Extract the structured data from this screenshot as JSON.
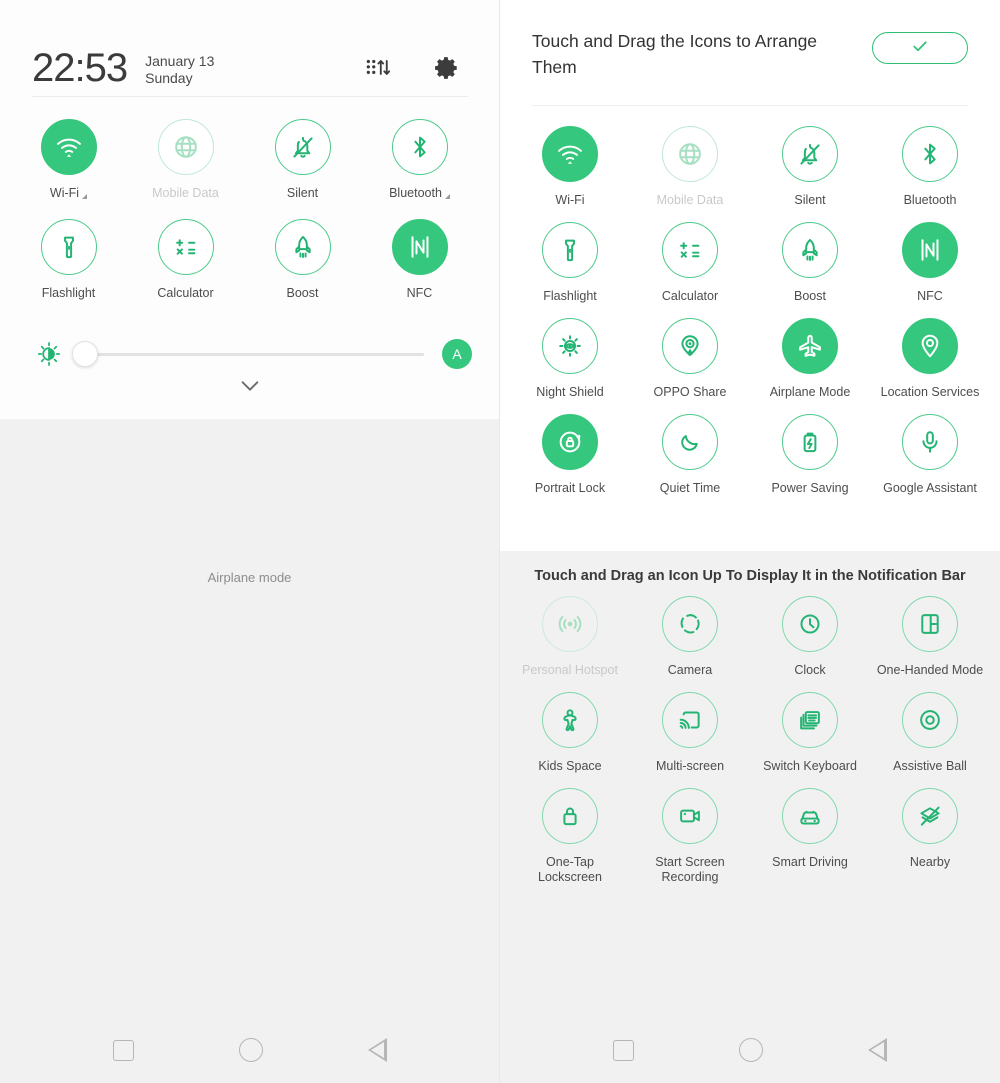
{
  "colors": {
    "accent": "#35c77d",
    "accent_stroke": "#23b473",
    "ring": "#4ccb8a",
    "ring_light": "#7fd9ac",
    "disabled": "#c9c9c9",
    "panel_bg": "#f1f1f1",
    "text": "#4d4d4d"
  },
  "left_panel": {
    "status": {
      "time": "22:53",
      "date": "January 13",
      "weekday": "Sunday",
      "edit_icon": "drag-sort-icon",
      "settings_icon": "gear-icon"
    },
    "tiles": [
      [
        {
          "label": "Wi-Fi",
          "icon": "wifi-icon",
          "state": "on",
          "expandable": true
        },
        {
          "label": "Mobile Data",
          "icon": "globe-icon",
          "state": "disabled",
          "expandable": false
        },
        {
          "label": "Silent",
          "icon": "bell-off-icon",
          "state": "off",
          "expandable": false
        },
        {
          "label": "Bluetooth",
          "icon": "bluetooth-icon",
          "state": "off",
          "expandable": true
        }
      ],
      [
        {
          "label": "Flashlight",
          "icon": "flashlight-icon",
          "state": "off",
          "expandable": false
        },
        {
          "label": "Calculator",
          "icon": "calculator-icon",
          "state": "off",
          "expandable": false
        },
        {
          "label": "Boost",
          "icon": "rocket-icon",
          "state": "off",
          "expandable": false
        },
        {
          "label": "NFC",
          "icon": "nfc-icon",
          "state": "on",
          "expandable": false
        }
      ]
    ],
    "brightness": {
      "icon": "brightness-icon",
      "value": 0,
      "auto_label": "A",
      "expand_icon": "chevron-down-icon"
    },
    "toast": "Airplane mode"
  },
  "right_panel": {
    "header": {
      "title": "Touch and Drag the Icons to Arrange Them",
      "done_icon": "check-icon"
    },
    "active_tiles": [
      [
        {
          "label": "Wi-Fi",
          "icon": "wifi-icon",
          "state": "on"
        },
        {
          "label": "Mobile Data",
          "icon": "globe-icon",
          "state": "disabled"
        },
        {
          "label": "Silent",
          "icon": "bell-off-icon",
          "state": "off"
        },
        {
          "label": "Bluetooth",
          "icon": "bluetooth-icon",
          "state": "off"
        }
      ],
      [
        {
          "label": "Flashlight",
          "icon": "flashlight-icon",
          "state": "off"
        },
        {
          "label": "Calculator",
          "icon": "calculator-icon",
          "state": "off"
        },
        {
          "label": "Boost",
          "icon": "rocket-icon",
          "state": "off"
        },
        {
          "label": "NFC",
          "icon": "nfc-icon",
          "state": "on"
        }
      ],
      [
        {
          "label": "Night Shield",
          "icon": "night-shield-icon",
          "state": "off"
        },
        {
          "label": "OPPO Share",
          "icon": "oppo-share-icon",
          "state": "off"
        },
        {
          "label": "Airplane Mode",
          "icon": "airplane-icon",
          "state": "on"
        },
        {
          "label": "Location Services",
          "icon": "location-pin-icon",
          "state": "on"
        }
      ],
      [
        {
          "label": "Portrait Lock",
          "icon": "rotation-lock-icon",
          "state": "on"
        },
        {
          "label": "Quiet Time",
          "icon": "moon-icon",
          "state": "off"
        },
        {
          "label": "Power Saving",
          "icon": "battery-bolt-icon",
          "state": "off"
        },
        {
          "label": "Google Assistant",
          "icon": "microphone-icon",
          "state": "off"
        }
      ]
    ],
    "lower": {
      "title": "Touch and Drag an Icon Up To Display It in the Notification Bar",
      "tiles": [
        [
          {
            "label": "Personal Hotspot",
            "icon": "hotspot-icon",
            "state": "disabled"
          },
          {
            "label": "Camera",
            "icon": "camera-shutter-icon",
            "state": "off"
          },
          {
            "label": "Clock",
            "icon": "clock-icon",
            "state": "off"
          },
          {
            "label": "One-Handed Mode",
            "icon": "one-handed-icon",
            "state": "off"
          }
        ],
        [
          {
            "label": "Kids Space",
            "icon": "kids-space-icon",
            "state": "off"
          },
          {
            "label": "Multi-screen",
            "icon": "cast-icon",
            "state": "off"
          },
          {
            "label": "Switch Keyboard",
            "icon": "keyboard-icon",
            "state": "off"
          },
          {
            "label": "Assistive Ball",
            "icon": "assistive-ball-icon",
            "state": "off"
          }
        ],
        [
          {
            "label": "One-Tap Lockscreen",
            "icon": "padlock-icon",
            "state": "off"
          },
          {
            "label": "Start Screen Recording",
            "icon": "video-camera-icon",
            "state": "off"
          },
          {
            "label": "Smart Driving",
            "icon": "car-icon",
            "state": "off"
          },
          {
            "label": "Nearby",
            "icon": "nearby-off-icon",
            "state": "off"
          }
        ]
      ]
    }
  },
  "navbar": {
    "recents": "recents-square-icon",
    "home": "home-circle-icon",
    "back": "back-triangle-icon"
  }
}
